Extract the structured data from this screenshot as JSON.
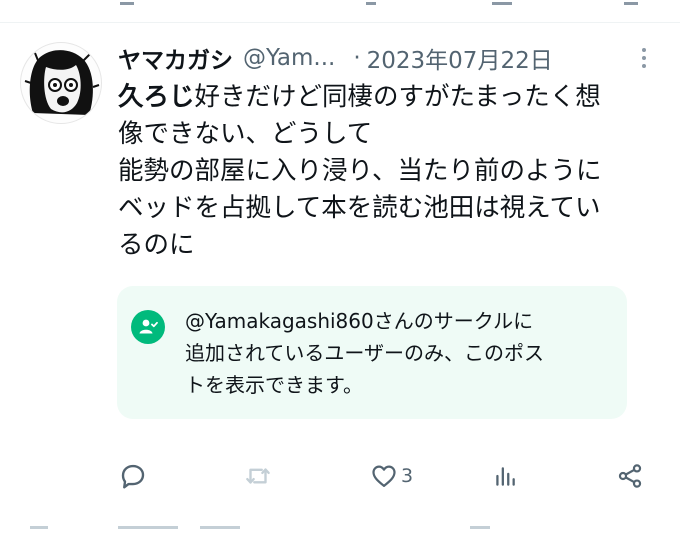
{
  "post": {
    "display_name": "ヤマカガシ",
    "handle": "@Yam...",
    "separator": "·",
    "date": "2023年07月22日",
    "text_lines": [
      {
        "bold": "久ろじ",
        "rest": "好きだけど同棲のすがたまったく想"
      },
      {
        "bold": "",
        "rest": "像できない、どうして"
      },
      {
        "bold": "",
        "rest": "能勢の部屋に入り浸り、当たり前のように"
      },
      {
        "bold": "",
        "rest": "ベッドを占拠して本を読む池田は視えてい"
      },
      {
        "bold": "",
        "rest": "るのに"
      }
    ],
    "circle_notice_lines": [
      "@Yamakagashi860さんのサークルに",
      "追加されているユーザーのみ、このポス",
      "トを表示できます。"
    ]
  },
  "actions": {
    "reply_icon": "reply-icon",
    "repost_icon": "repost-icon",
    "like_icon": "heart-icon",
    "like_count": "3",
    "views_icon": "views-icon",
    "share_icon": "share-icon"
  },
  "colors": {
    "text": "#0f1419",
    "secondary": "#536471",
    "circle_bg": "#effbf6",
    "circle_accent": "#00ba7c"
  }
}
